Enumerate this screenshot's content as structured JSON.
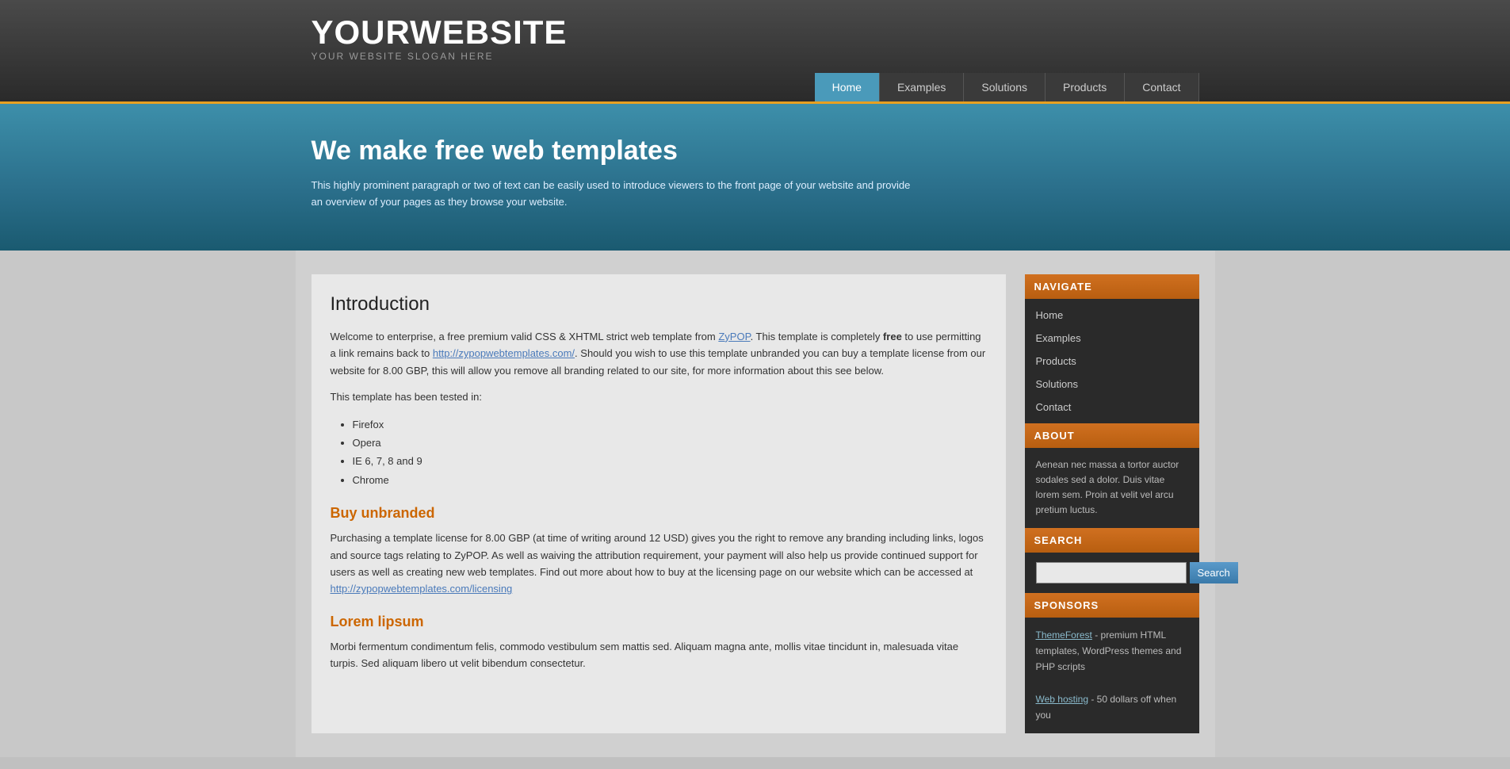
{
  "header": {
    "site_title": "YOURWEBSITE",
    "site_slogan": "YOUR WEBSITE SLOGAN HERE",
    "nav_items": [
      {
        "label": "Home",
        "active": true
      },
      {
        "label": "Examples",
        "active": false
      },
      {
        "label": "Solutions",
        "active": false
      },
      {
        "label": "Products",
        "active": false
      },
      {
        "label": "Contact",
        "active": false
      }
    ]
  },
  "hero": {
    "heading": "We make free web templates",
    "description": "This highly prominent paragraph or two of text can be easily used to introduce viewers to the front page of your website and provide an overview of your pages as they browse your website."
  },
  "content": {
    "intro_heading": "Introduction",
    "intro_p1": "Welcome to enterprise, a free premium valid CSS & XHTML strict web template from ZyPOP. This template is completely free to use permitting a link remains back to http://zypopwebtemplates.com/. Should you wish to use this template unbranded you can buy a template license from our website for 8.00 GBP, this will allow you remove all branding related to our site, for more information about this see below.",
    "intro_p2": "This template has been tested in:",
    "tested_list": [
      "Firefox",
      "Opera",
      "IE 6, 7, 8 and 9",
      "Chrome"
    ],
    "buy_heading": "Buy unbranded",
    "buy_p": "Purchasing a template license for 8.00 GBP (at time of writing around 12 USD) gives you the right to remove any branding including links, logos and source tags relating to ZyPOP. As well as waiving the attribution requirement, your payment will also help us provide continued support for users as well as creating new web templates. Find out more about how to buy at the licensing page on our website which can be accessed at http://zypopwebtemplates.com/licensing",
    "lorem_heading": "Lorem lipsum",
    "lorem_p": "Morbi fermentum condimentum felis, commodo vestibulum sem mattis sed. Aliquam magna ante, mollis vitae tincidunt in, malesuada vitae turpis. Sed aliquam libero ut velit bibendum consectetur.",
    "intro_link_zypop": "ZyPOP",
    "intro_link_url": "http://zypopwebtemplates.com/",
    "buy_link_url": "http://zypopwebtemplates.com/licensing"
  },
  "sidebar": {
    "navigate_label": "NAVIGATE",
    "nav_items": [
      "Home",
      "Examples",
      "Products",
      "Solutions",
      "Contact"
    ],
    "about_label": "ABOUT",
    "about_text": "Aenean nec massa a tortor auctor sodales sed a dolor. Duis vitae lorem sem. Proin at velit vel arcu pretium luctus.",
    "search_label": "SEARCH",
    "search_placeholder": "",
    "search_button": "Search",
    "sponsors_label": "SPONSORS",
    "sponsor1_name": "ThemeForest",
    "sponsor1_desc": " - premium HTML templates, WordPress themes and PHP scripts",
    "sponsor2_name": "Web hosting",
    "sponsor2_desc": " - 50 dollars off when you"
  }
}
